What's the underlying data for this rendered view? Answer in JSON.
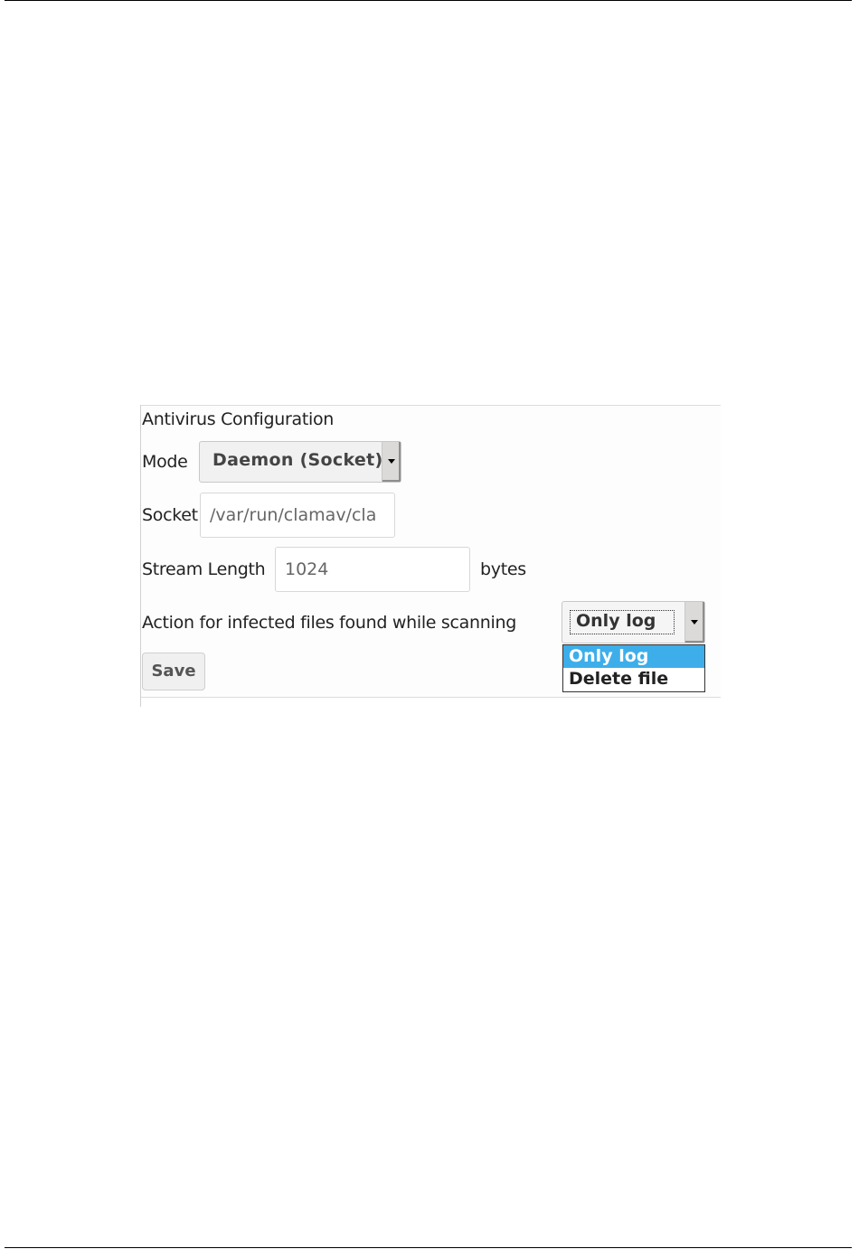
{
  "panel": {
    "title": "Antivirus Configuration"
  },
  "mode": {
    "label": "Mode",
    "selected": "Daemon (Socket)"
  },
  "socket": {
    "label": "Socket",
    "value": "/var/run/clamav/cla"
  },
  "stream_length": {
    "label": "Stream Length",
    "value": "1024",
    "unit": "bytes"
  },
  "action": {
    "label": "Action for infected files found while scanning",
    "selected": "Only log",
    "options": [
      "Only log",
      "Delete file"
    ],
    "highlight_color": "#3daee9"
  },
  "buttons": {
    "save": "Save"
  }
}
